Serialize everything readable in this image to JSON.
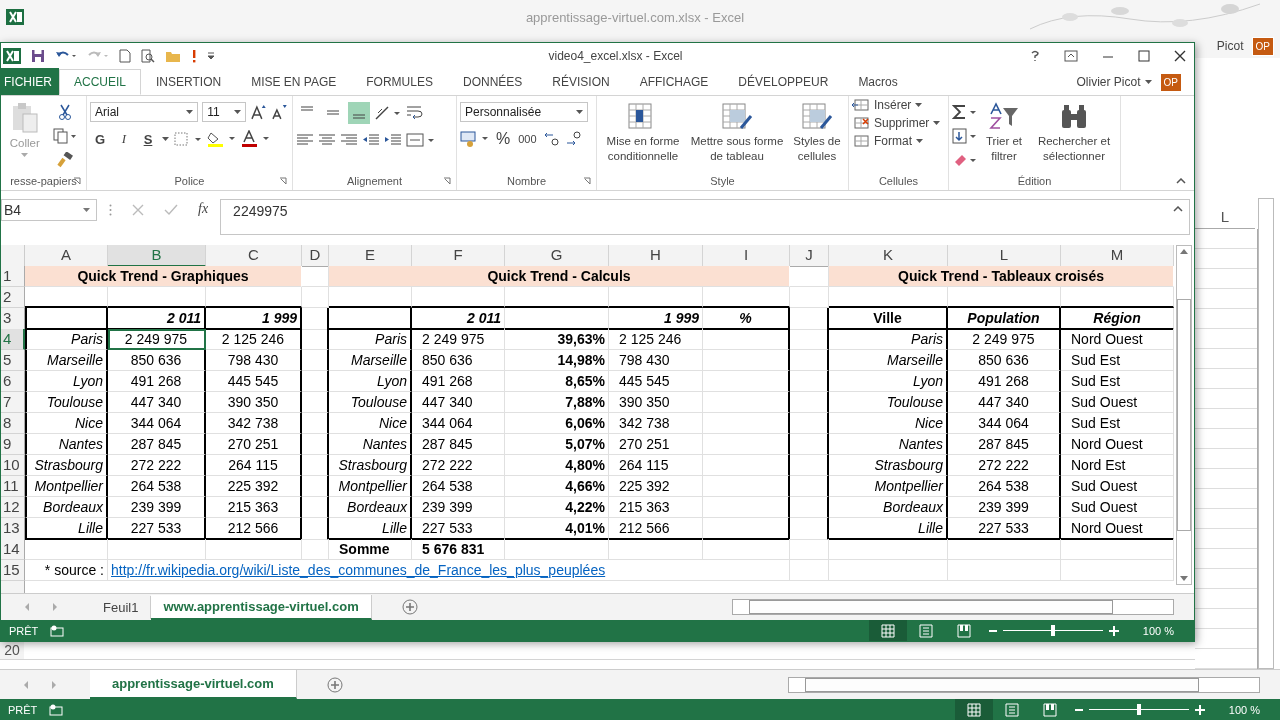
{
  "background_window": {
    "title": "apprentissage-virtuel.com.xlsx - Excel",
    "user": "Picot",
    "avatar": "OP",
    "column_header": "L",
    "row_numbers": [
      "20"
    ],
    "sheet_tabs": [
      {
        "label": "apprentissage-virtuel.com",
        "selected": true
      }
    ],
    "status": "PRÊT",
    "zoom": {
      "label": "100 %",
      "level": 0.5
    }
  },
  "window": {
    "title": "video4_excel.xlsx - Excel",
    "user": "Olivier Picot",
    "avatar": "OP"
  },
  "ribbon_tabs": [
    {
      "label": "FICHIER",
      "kind": "file",
      "selected": false
    },
    {
      "label": "ACCUEIL",
      "kind": "tab",
      "selected": true
    },
    {
      "label": "INSERTION",
      "kind": "tab",
      "selected": false
    },
    {
      "label": "MISE EN PAGE",
      "kind": "tab",
      "selected": false
    },
    {
      "label": "FORMULES",
      "kind": "tab",
      "selected": false
    },
    {
      "label": "DONNÉES",
      "kind": "tab",
      "selected": false
    },
    {
      "label": "RÉVISION",
      "kind": "tab",
      "selected": false
    },
    {
      "label": "AFFICHAGE",
      "kind": "tab",
      "selected": false
    },
    {
      "label": "DÉVELOPPEUR",
      "kind": "tab",
      "selected": false
    },
    {
      "label": "Macros",
      "kind": "tab",
      "selected": false
    }
  ],
  "ribbon": {
    "clipboard": {
      "label": "resse-papiers",
      "paste": "Coller"
    },
    "font": {
      "label": "Police",
      "name": "Arial",
      "size": "11",
      "bold": "G",
      "italic": "I",
      "underline": "S"
    },
    "alignment": {
      "label": "Alignement",
      "vertical": [
        {
          "selected": false
        },
        {
          "selected": false
        },
        {
          "selected": true
        }
      ]
    },
    "number": {
      "label": "Nombre",
      "format": "Personnalisée",
      "percent": "%",
      "thousands": "000"
    },
    "style": {
      "label": "Style",
      "buttons": [
        "Mise en forme conditionnelle",
        "Mettre sous forme de tableau",
        "Styles de cellules"
      ]
    },
    "cells": {
      "label": "Cellules",
      "buttons": [
        "Insérer",
        "Supprimer",
        "Format"
      ]
    },
    "editing": {
      "label": "Édition",
      "buttons": [
        "Trier et filtrer",
        "Rechercher et sélectionner"
      ]
    }
  },
  "formula_bar": {
    "name_box": "B4",
    "function_label": "fx",
    "value": "2249975"
  },
  "sheet": {
    "columns": [
      {
        "label": "A",
        "selected": false
      },
      {
        "label": "B",
        "selected": true
      },
      {
        "label": "C",
        "selected": false
      },
      {
        "label": "D",
        "selected": false
      },
      {
        "label": "E",
        "selected": false
      },
      {
        "label": "F",
        "selected": false
      },
      {
        "label": "G",
        "selected": false
      },
      {
        "label": "H",
        "selected": false
      },
      {
        "label": "I",
        "selected": false
      },
      {
        "label": "J",
        "selected": false
      },
      {
        "label": "K",
        "selected": false
      },
      {
        "label": "L",
        "selected": false
      },
      {
        "label": "M",
        "selected": false
      }
    ],
    "rows": [
      {
        "label": "1",
        "selected": false
      },
      {
        "label": "2",
        "selected": false
      },
      {
        "label": "3",
        "selected": false
      },
      {
        "label": "4",
        "selected": true
      },
      {
        "label": "5",
        "selected": false
      },
      {
        "label": "6",
        "selected": false
      },
      {
        "label": "7",
        "selected": false
      },
      {
        "label": "8",
        "selected": false
      },
      {
        "label": "9",
        "selected": false
      },
      {
        "label": "10",
        "selected": false
      },
      {
        "label": "11",
        "selected": false
      },
      {
        "label": "12",
        "selected": false
      },
      {
        "label": "13",
        "selected": false
      },
      {
        "label": "14",
        "selected": false
      },
      {
        "label": "15",
        "selected": false
      }
    ],
    "graphiques": {
      "title": "Quick Trend - Graphiques",
      "headers": [
        "2 011",
        "1 999"
      ],
      "rows": [
        {
          "city": "Paris",
          "v2011": "2 249 975",
          "v1999": "2 125 246"
        },
        {
          "city": "Marseille",
          "v2011": "850 636",
          "v1999": "798 430"
        },
        {
          "city": "Lyon",
          "v2011": "491 268",
          "v1999": "445 545"
        },
        {
          "city": "Toulouse",
          "v2011": "447 340",
          "v1999": "390 350"
        },
        {
          "city": "Nice",
          "v2011": "344 064",
          "v1999": "342 738"
        },
        {
          "city": "Nantes",
          "v2011": "287 845",
          "v1999": "270 251"
        },
        {
          "city": "Strasbourg",
          "v2011": "272 222",
          "v1999": "264 115"
        },
        {
          "city": "Montpellier",
          "v2011": "264 538",
          "v1999": "225 392"
        },
        {
          "city": "Bordeaux",
          "v2011": "239 399",
          "v1999": "215 363"
        },
        {
          "city": "Lille",
          "v2011": "227 533",
          "v1999": "212 566"
        }
      ]
    },
    "calculs": {
      "title": "Quick Trend - Calculs",
      "headers": [
        "2 011",
        "1 999",
        "%"
      ],
      "rows": [
        {
          "city": "Paris",
          "v2011": "2 249 975",
          "share": "39,63%",
          "v1999": "2 125 246"
        },
        {
          "city": "Marseille",
          "v2011": "850 636",
          "share": "14,98%",
          "v1999": "798 430"
        },
        {
          "city": "Lyon",
          "v2011": "491 268",
          "share": "8,65%",
          "v1999": "445 545"
        },
        {
          "city": "Toulouse",
          "v2011": "447 340",
          "share": "7,88%",
          "v1999": "390 350"
        },
        {
          "city": "Nice",
          "v2011": "344 064",
          "share": "6,06%",
          "v1999": "342 738"
        },
        {
          "city": "Nantes",
          "v2011": "287 845",
          "share": "5,07%",
          "v1999": "270 251"
        },
        {
          "city": "Strasbourg",
          "v2011": "272 222",
          "share": "4,80%",
          "v1999": "264 115"
        },
        {
          "city": "Montpellier",
          "v2011": "264 538",
          "share": "4,66%",
          "v1999": "225 392"
        },
        {
          "city": "Bordeaux",
          "v2011": "239 399",
          "share": "4,22%",
          "v1999": "215 363"
        },
        {
          "city": "Lille",
          "v2011": "227 533",
          "share": "4,01%",
          "v1999": "212 566"
        }
      ],
      "total": {
        "label": "Somme",
        "value": "5 676 831"
      }
    },
    "tableaux": {
      "title": "Quick Trend - Tableaux croisés",
      "headers": [
        "Ville",
        "Population",
        "Région"
      ],
      "rows": [
        {
          "city": "Paris",
          "population": "2 249 975",
          "region": "Nord Ouest"
        },
        {
          "city": "Marseille",
          "population": "850 636",
          "region": "Sud Est"
        },
        {
          "city": "Lyon",
          "population": "491 268",
          "region": "Sud Est"
        },
        {
          "city": "Toulouse",
          "population": "447 340",
          "region": "Sud Ouest"
        },
        {
          "city": "Nice",
          "population": "344 064",
          "region": "Sud Est"
        },
        {
          "city": "Nantes",
          "population": "287 845",
          "region": "Nord Ouest"
        },
        {
          "city": "Strasbourg",
          "population": "272 222",
          "region": "Nord Est"
        },
        {
          "city": "Montpellier",
          "population": "264 538",
          "region": "Sud Ouest"
        },
        {
          "city": "Bordeaux",
          "population": "239 399",
          "region": "Sud Ouest"
        },
        {
          "city": "Lille",
          "population": "227 533",
          "region": "Nord Ouest"
        }
      ]
    },
    "note": {
      "label": "* source :",
      "link": "http://fr.wikipedia.org/wiki/Liste_des_communes_de_France_les_plus_peuplées"
    }
  },
  "sheet_tabs": [
    {
      "label": "Feuil1",
      "selected": false
    },
    {
      "label": "www.apprentissage-virtuel.com",
      "selected": true
    }
  ],
  "status": "PRÊT",
  "zoom": {
    "label": "100 %",
    "level": 0.5
  }
}
